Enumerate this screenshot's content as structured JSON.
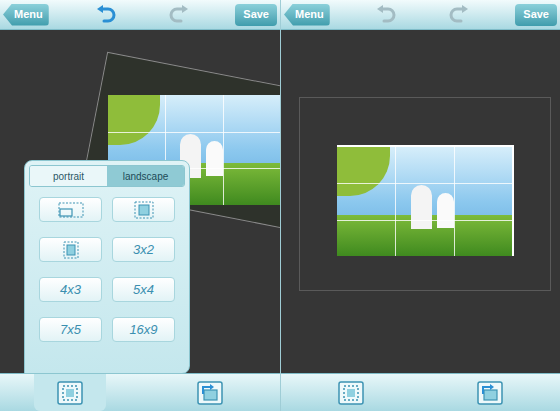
{
  "screens": [
    {
      "toolbar": {
        "menu": "Menu",
        "save": "Save",
        "undo_enabled": true,
        "redo_enabled": false
      },
      "photo": {
        "rotated": true
      },
      "crop_panel": {
        "tabs": [
          {
            "label": "portrait",
            "selected": false
          },
          {
            "label": "landscape",
            "selected": true
          }
        ],
        "options": [
          {
            "kind": "icon",
            "label": ""
          },
          {
            "kind": "icon",
            "label": ""
          },
          {
            "kind": "icon",
            "label": ""
          },
          {
            "kind": "ratio",
            "label": "3x2"
          },
          {
            "kind": "ratio",
            "label": "4x3"
          },
          {
            "kind": "ratio",
            "label": "5x4"
          },
          {
            "kind": "ratio",
            "label": "7x5"
          },
          {
            "kind": "ratio",
            "label": "16x9"
          }
        ]
      },
      "bottom_bar": {
        "crop_selected": true
      }
    },
    {
      "toolbar": {
        "menu": "Menu",
        "save": "Save",
        "undo_enabled": false,
        "redo_enabled": false
      },
      "photo": {
        "rotated": false
      },
      "crop_panel": null,
      "bottom_bar": {
        "crop_selected": false
      }
    }
  ]
}
